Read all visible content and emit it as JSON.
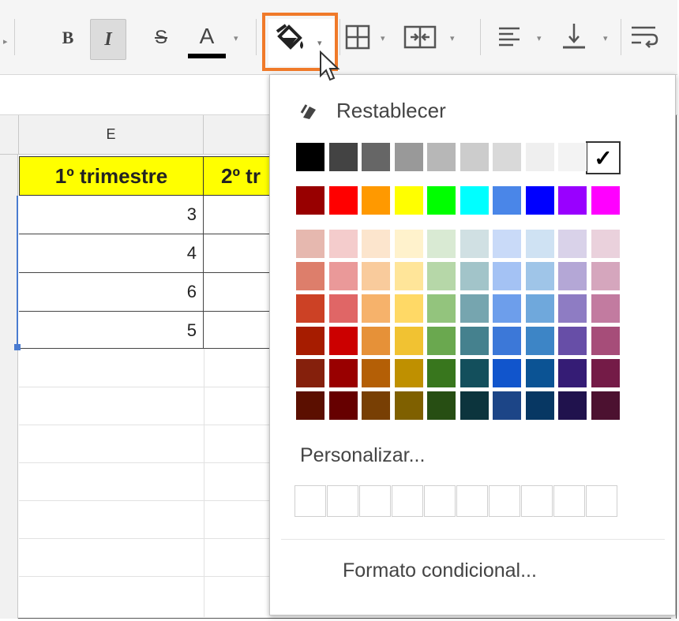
{
  "toolbar": {
    "bold_label": "B",
    "italic_label": "I",
    "strike_label": "S",
    "text_color_label": "A",
    "text_color_bar": "#000000",
    "highlight_color": "#f07a2a"
  },
  "sheet": {
    "column_letter": "E",
    "header_1": "1º trimestre",
    "header_2": "2º tr",
    "values": [
      "3",
      "4",
      "6",
      "5"
    ],
    "header_bg": "#ffff00"
  },
  "popup": {
    "reset_label": "Restablecer",
    "custom_label": "Personalizar...",
    "conditional_label": "Formato condicional...",
    "selected_mark": "✓",
    "gray_row": [
      "#000000",
      "#434343",
      "#666666",
      "#999999",
      "#b7b7b7",
      "#cccccc",
      "#d9d9d9",
      "#efefef",
      "#f3f3f3",
      "#ffffff"
    ],
    "bright_row": [
      "#980000",
      "#ff0000",
      "#ff9900",
      "#ffff00",
      "#00ff00",
      "#00ffff",
      "#4a86e8",
      "#0000ff",
      "#9900ff",
      "#ff00ff"
    ],
    "shade_rows": [
      [
        "#e6b8af",
        "#f4cccc",
        "#fce5cd",
        "#fff2cc",
        "#d9ead3",
        "#d0e0e3",
        "#c9daf8",
        "#cfe2f3",
        "#d9d2e9",
        "#ead1dc"
      ],
      [
        "#dd7e6b",
        "#ea9999",
        "#f9cb9c",
        "#ffe599",
        "#b6d7a8",
        "#a2c4c9",
        "#a4c2f4",
        "#9fc5e8",
        "#b4a7d6",
        "#d5a6bd"
      ],
      [
        "#cc4125",
        "#e06666",
        "#f6b26b",
        "#ffd966",
        "#93c47d",
        "#76a5af",
        "#6d9eeb",
        "#6fa8dc",
        "#8e7cc3",
        "#c27ba0"
      ],
      [
        "#a61c00",
        "#cc0000",
        "#e69138",
        "#f1c232",
        "#6aa84f",
        "#45818e",
        "#3c78d8",
        "#3d85c6",
        "#674ea7",
        "#a64d79"
      ],
      [
        "#85200c",
        "#990000",
        "#b45f06",
        "#bf9000",
        "#38761d",
        "#134f5c",
        "#1155cc",
        "#0b5394",
        "#351c75",
        "#741b47"
      ],
      [
        "#5b0f00",
        "#660000",
        "#783f04",
        "#7f6000",
        "#274e13",
        "#0c343d",
        "#1c4587",
        "#073763",
        "#20124d",
        "#4c1130"
      ]
    ]
  },
  "icons": {
    "fill": "paint-bucket-icon",
    "borders": "borders-icon",
    "merge": "merge-cells-icon",
    "align": "align-left-icon",
    "valign": "vertical-align-bottom-icon",
    "wrap": "text-wrap-icon",
    "reset": "reset-eraser-icon",
    "cursor": "mouse-cursor-icon"
  }
}
